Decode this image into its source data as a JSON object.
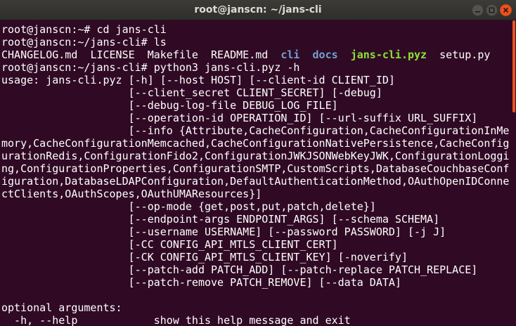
{
  "window": {
    "title": "root@janscn: ~/jans-cli"
  },
  "icons": {
    "minimize": "minimize-icon",
    "maximize": "maximize-icon",
    "close": "close-icon"
  },
  "colors": {
    "background": "#300a24",
    "text": "#ffffff",
    "directory": "#729fcf",
    "executable": "#8ae234",
    "close_button": "#e95420"
  },
  "terminal": {
    "lines": [
      "root@janscn:~# cd jans-cli",
      "root@janscn:~/jans-cli# ls",
      "",
      "root@janscn:~/jans-cli# python3 jans-cli.pyz -h",
      "usage: jans-cli.pyz [-h] [--host HOST] [--client-id CLIENT_ID]",
      "                    [--client_secret CLIENT_SECRET] [-debug]",
      "                    [--debug-log-file DEBUG_LOG_FILE]",
      "                    [--operation-id OPERATION_ID] [--url-suffix URL_SUFFIX]",
      "                    [--info {Attribute,CacheConfiguration,CacheConfigurationInMe",
      "mory,CacheConfigurationMemcached,CacheConfigurationNativePersistence,CacheConfig",
      "urationRedis,ConfigurationFido2,ConfigurationJWKJSONWebKeyJWK,ConfigurationLoggi",
      "ng,ConfigurationProperties,ConfigurationSMTP,CustomScripts,DatabaseCouchbaseConf",
      "iguration,DatabaseLDAPConfiguration,DefaultAuthenticationMethod,OAuthOpenIDConne",
      "ctClients,OAuthScopes,OAuthUMAResources}]",
      "                    [--op-mode {get,post,put,patch,delete}]",
      "                    [--endpoint-args ENDPOINT_ARGS] [--schema SCHEMA]",
      "                    [--username USERNAME] [--password PASSWORD] [-j J]",
      "                    [-CC CONFIG_API_MTLS_CLIENT_CERT]",
      "                    [-CK CONFIG_API_MTLS_CLIENT_KEY] [-noverify]",
      "                    [--patch-add PATCH_ADD] [--patch-replace PATCH_REPLACE]",
      "                    [--patch-remove PATCH_REMOVE] [--data DATA]",
      "",
      "optional arguments:",
      "  -h, --help            show this help message and exit"
    ],
    "ls_output": {
      "changelog": "CHANGELOG.md",
      "license": "LICENSE",
      "makefile": "Makefile",
      "readme": "README.md",
      "cli_dir": "cli",
      "docs_dir": "docs",
      "pyz_exec": "jans-cli.pyz",
      "setup": "setup.py"
    }
  }
}
